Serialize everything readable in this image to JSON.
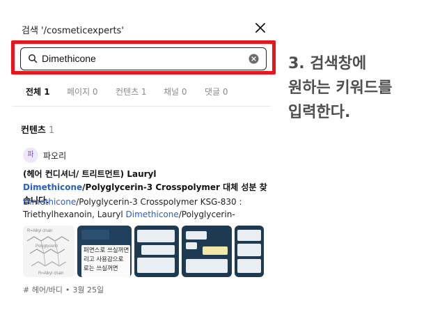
{
  "header": {
    "title": "검색 '/cosmeticexperts'"
  },
  "search": {
    "value": "Dimethicone"
  },
  "tabs": [
    {
      "label": "전체 1",
      "active": true
    },
    {
      "label": "페이지 0",
      "active": false
    },
    {
      "label": "컨텐츠 1",
      "active": false
    },
    {
      "label": "채널 0",
      "active": false
    },
    {
      "label": "댓글 0",
      "active": false
    }
  ],
  "section": {
    "title": "컨텐츠",
    "count": "1"
  },
  "post": {
    "author_avatar": "파",
    "author": "파오리",
    "title_parts": [
      "(헤어 컨디셔너/ 트리트먼트) Lauryl ",
      "Dimethicone",
      "/Polyglycerin-3 Crosspolymer 대체 성분 찾습니다."
    ],
    "excerpt_line1": [
      "Dimethicone",
      "/Polyglycerin-3 Crosspolymer KSG-830 :"
    ],
    "excerpt_line2": [
      "Triethylhexanoin, Lauryl ",
      "Dimethicone",
      "/Polyglycerin-"
    ],
    "thumb2_lines": [
      "퍼면스로 쓰실꺼면",
      "리고 사용감으로",
      "로는 쓰실꺼면"
    ],
    "thumb1_labels": [
      "R=Alkyl chain",
      "Polyglycerin",
      "R=Alkyl chain"
    ],
    "tag": "# 헤어/바디",
    "date": "3월 25일"
  },
  "annotation": {
    "lines": [
      "3. 검색창에",
      "원하는 키워드를",
      "입력한다."
    ]
  },
  "colors": {
    "highlight": "#e8151c",
    "keyword": "#2b5fc7",
    "annotation": "#4e4e4e",
    "avatar_bg": "#efe6fb"
  },
  "icons": {
    "close": "close-icon",
    "search": "search-icon",
    "clear": "clear-icon"
  }
}
